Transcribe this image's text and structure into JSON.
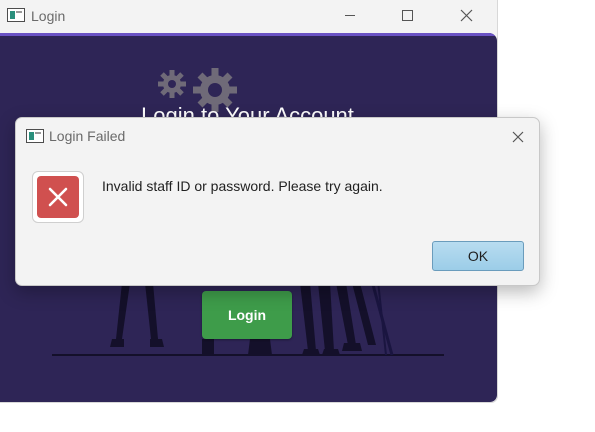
{
  "main_window": {
    "title": "Login",
    "heading": "Login to Your Account",
    "login_button_label": "Login",
    "controls": {
      "minimize": "minimize-icon",
      "maximize": "maximize-icon",
      "close": "close-icon"
    }
  },
  "dialog": {
    "title": "Login Failed",
    "message": "Invalid staff ID or password. Please try again.",
    "ok_label": "OK",
    "icon": "error-icon"
  },
  "colors": {
    "content_background": "#2e2556",
    "accent": "#6a52c4",
    "login_button": "#3e9c4a",
    "error_icon": "#d0504f",
    "ok_button": "#a8d4ec"
  }
}
